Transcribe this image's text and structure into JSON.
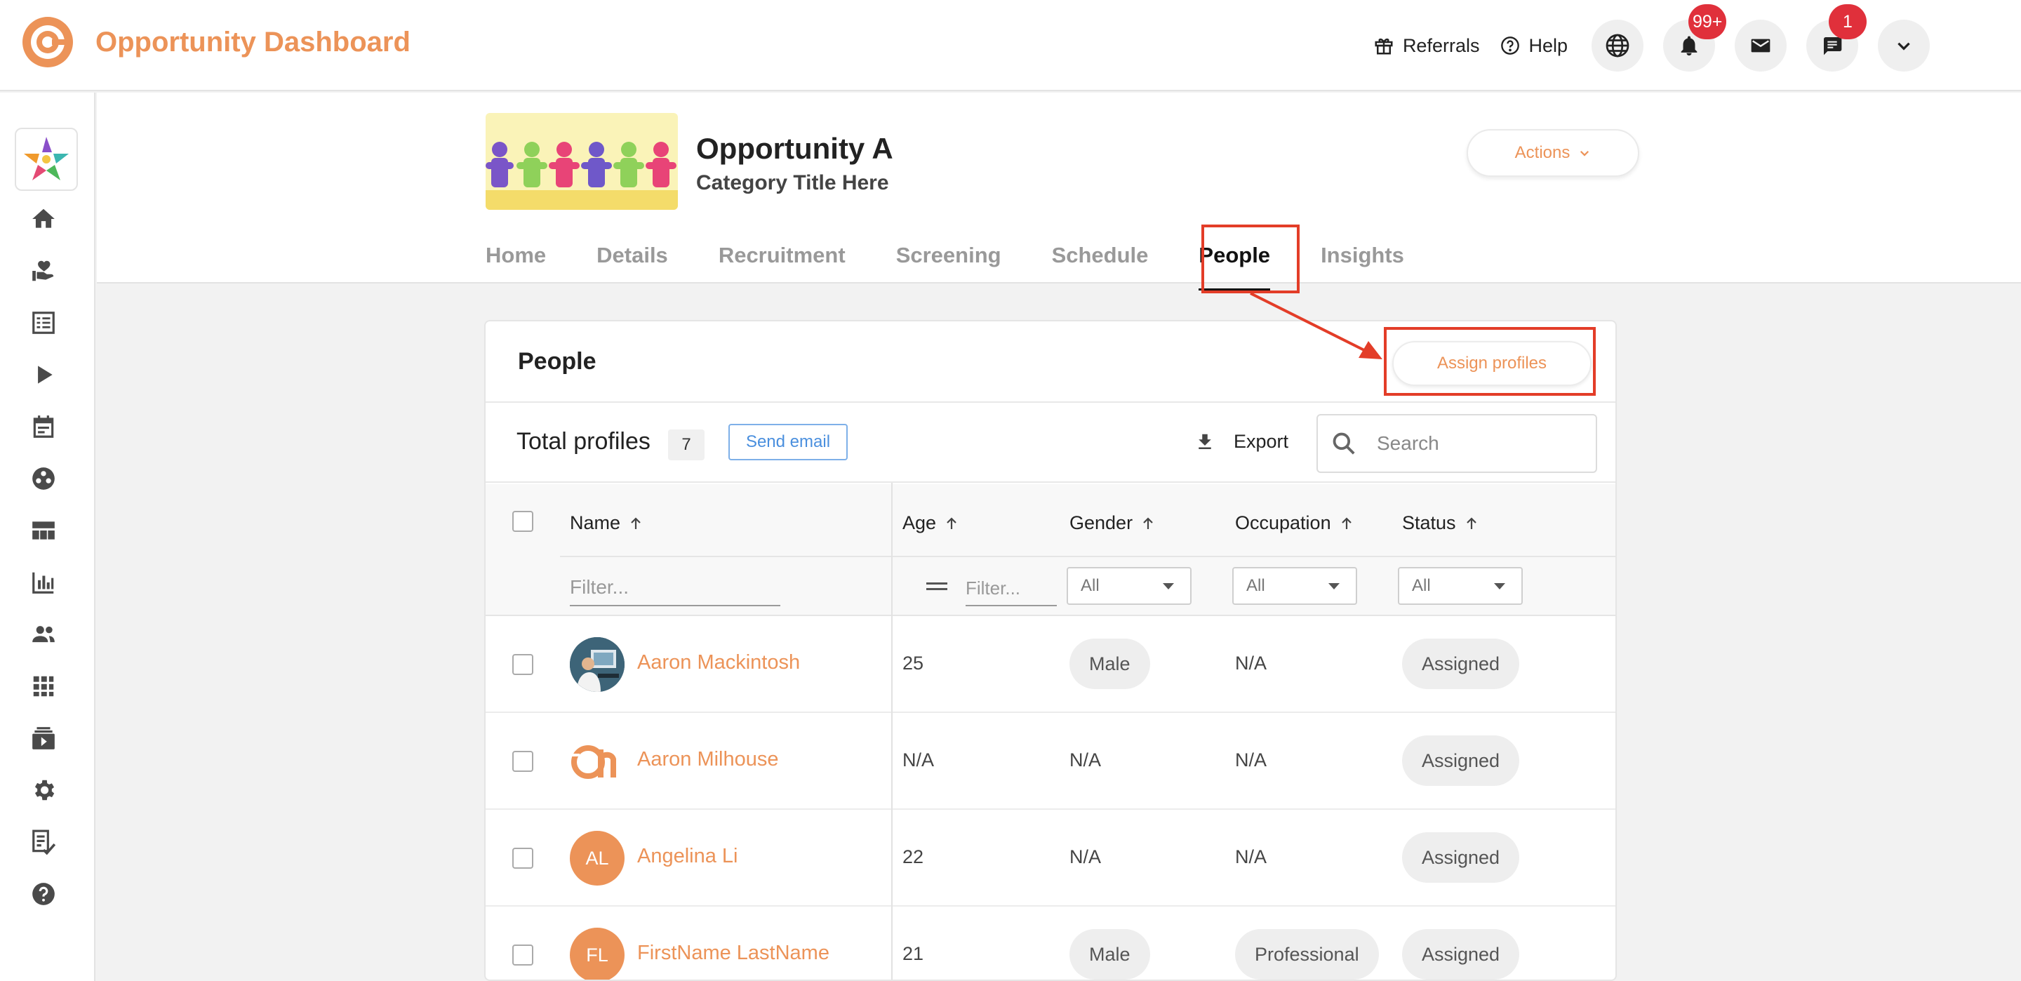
{
  "app": {
    "title": "Opportunity Dashboard"
  },
  "topbar": {
    "referrals_label": "Referrals",
    "help_label": "Help",
    "notifications_badge": "99+",
    "messages_badge": "1"
  },
  "opportunity": {
    "title": "Opportunity A",
    "category": "Category Title Here",
    "actions_label": "Actions"
  },
  "tabs": [
    {
      "label": "Home"
    },
    {
      "label": "Details"
    },
    {
      "label": "Recruitment"
    },
    {
      "label": "Screening"
    },
    {
      "label": "Schedule"
    },
    {
      "label": "People"
    },
    {
      "label": "Insights"
    }
  ],
  "people_card": {
    "title": "People",
    "assign_label": "Assign profiles",
    "total_label": "Total profiles",
    "total_count": "7",
    "send_email_label": "Send email",
    "export_label": "Export",
    "search_placeholder": "Search"
  },
  "table": {
    "columns": {
      "name": "Name",
      "age": "Age",
      "gender": "Gender",
      "occupation": "Occupation",
      "status": "Status"
    },
    "filters": {
      "name_placeholder": "Filter...",
      "age_placeholder": "Filter...",
      "gender": "All",
      "occupation": "All",
      "status": "All"
    },
    "rows": [
      {
        "name": "Aaron Mackintosh",
        "age": "25",
        "gender": "Male",
        "occupation": "N/A",
        "status": "Assigned",
        "initials": ""
      },
      {
        "name": "Aaron Milhouse",
        "age": "N/A",
        "gender": "N/A",
        "occupation": "N/A",
        "status": "Assigned",
        "initials": ""
      },
      {
        "name": "Angelina Li",
        "age": "22",
        "gender": "N/A",
        "occupation": "N/A",
        "status": "Assigned",
        "initials": "AL"
      },
      {
        "name": "FirstName LastName",
        "age": "21",
        "gender": "Male",
        "occupation": "Professional",
        "status": "Assigned",
        "initials": "FL"
      }
    ]
  },
  "colors": {
    "brand": "#ec9358",
    "annotation": "#e33d28",
    "badge": "#e0303b",
    "link_blue": "#4a8fde"
  }
}
